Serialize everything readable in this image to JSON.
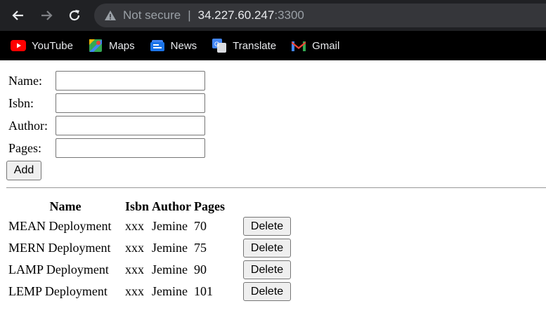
{
  "browser": {
    "not_secure": "Not secure",
    "separator": "|",
    "host": "34.227.60.247",
    "port": ":3300",
    "bookmarks": [
      {
        "label": "YouTube",
        "icon": "youtube-icon"
      },
      {
        "label": "Maps",
        "icon": "maps-icon"
      },
      {
        "label": "News",
        "icon": "news-icon"
      },
      {
        "label": "Translate",
        "icon": "translate-icon"
      },
      {
        "label": "Gmail",
        "icon": "gmail-icon"
      }
    ]
  },
  "form": {
    "name_label": "Name:",
    "isbn_label": "Isbn:",
    "author_label": "Author:",
    "pages_label": "Pages:",
    "name_value": "",
    "isbn_value": "",
    "author_value": "",
    "pages_value": "",
    "add_label": "Add"
  },
  "table": {
    "headers": [
      "Name",
      "Isbn",
      "Author",
      "Pages"
    ],
    "delete_label": "Delete",
    "rows": [
      {
        "name": "MEAN Deployment",
        "isbn": "xxx",
        "author": "Jemine",
        "pages": "70"
      },
      {
        "name": "MERN Deployment",
        "isbn": "xxx",
        "author": "Jemine",
        "pages": "75"
      },
      {
        "name": "LAMP Deployment",
        "isbn": "xxx",
        "author": "Jemine",
        "pages": "90"
      },
      {
        "name": "LEMP Deployment",
        "isbn": "xxx",
        "author": "Jemine",
        "pages": "101"
      }
    ]
  },
  "colors": {
    "chrome_bg": "#202124",
    "bookmark_bar_bg": "#000000",
    "omnibox_bg": "#35363a",
    "youtube_red": "#ff0000",
    "gmail_red": "#ea4335"
  }
}
